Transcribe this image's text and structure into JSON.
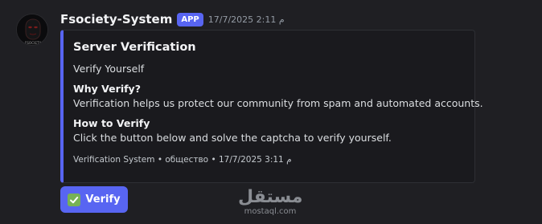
{
  "message": {
    "author": "Fsociety-System",
    "badge": "APP",
    "timestamp": "17/7/2025 2:11 م",
    "avatar_text": "FSOCIETY"
  },
  "embed": {
    "accent_color": "#5865f2",
    "title": "Server Verification",
    "description": "Verify Yourself",
    "fields": [
      {
        "name": "Why Verify?",
        "value": "Verification helps us protect our community from spam and automated accounts."
      },
      {
        "name": "How to Verify",
        "value": "Click the button below and solve the captcha to verify yourself."
      }
    ],
    "footer": "Verification System • общество • 17/7/2025 3:11 م"
  },
  "button": {
    "label": "Verify",
    "icon": "check-mark-button-icon",
    "color": "#5865f2"
  },
  "watermark": {
    "logo": "مستقل",
    "url": "mostaql.com"
  }
}
